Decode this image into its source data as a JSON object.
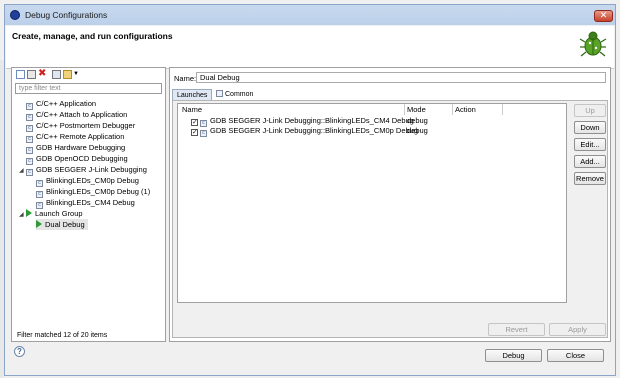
{
  "window": {
    "title": "Debug Configurations",
    "close_glyph": "✕"
  },
  "header": {
    "title": "Create, manage, and run configurations",
    "icon": "bug-icon"
  },
  "left_panel": {
    "filter_placeholder": "type filter text",
    "items": [
      {
        "label": "C/C++ Application",
        "icon": "c-app-icon"
      },
      {
        "label": "C/C++ Attach to Application",
        "icon": "c-app-icon"
      },
      {
        "label": "C/C++ Postmortem Debugger",
        "icon": "c-app-icon"
      },
      {
        "label": "C/C++ Remote Application",
        "icon": "c-app-icon"
      },
      {
        "label": "GDB Hardware Debugging",
        "icon": "c-app-icon"
      },
      {
        "label": "GDB OpenOCD Debugging",
        "icon": "c-app-icon"
      },
      {
        "label": "GDB SEGGER J-Link Debugging",
        "icon": "c-app-icon",
        "expanded": true
      },
      {
        "label": "BlinkingLEDs_CM0p Debug",
        "icon": "c-app-icon"
      },
      {
        "label": "BlinkingLEDs_CM0p Debug (1)",
        "icon": "c-app-icon"
      },
      {
        "label": "BlinkingLEDs_CM4 Debug",
        "icon": "c-app-icon"
      },
      {
        "label": "Launch Group",
        "icon": "launch-group-icon",
        "expanded": true
      },
      {
        "label": "Dual Debug",
        "icon": "launch-group-icon",
        "selected": true
      }
    ],
    "filter_status": "Filter matched 12 of 20 items"
  },
  "config": {
    "name_label": "Name:",
    "name_value": "Dual Debug",
    "tabs": [
      {
        "label": "Launches"
      },
      {
        "label": "Common"
      }
    ],
    "table": {
      "headers": [
        "Name",
        "Mode",
        "Action"
      ],
      "rows": [
        {
          "name": "GDB SEGGER J-Link Debugging::BlinkingLEDs_CM4 Debug",
          "mode": "debug",
          "action": "",
          "checked": true
        },
        {
          "name": "GDB SEGGER J-Link Debugging::BlinkingLEDs_CM0p Debug",
          "mode": "debug",
          "action": "",
          "checked": true
        }
      ]
    },
    "buttons": {
      "up": "Up",
      "down": "Down",
      "edit": "Edit...",
      "add": "Add...",
      "remove": "Remove"
    },
    "revert": "Revert",
    "apply": "Apply"
  },
  "footer": {
    "help_glyph": "?",
    "debug": "Debug",
    "close": "Close"
  }
}
